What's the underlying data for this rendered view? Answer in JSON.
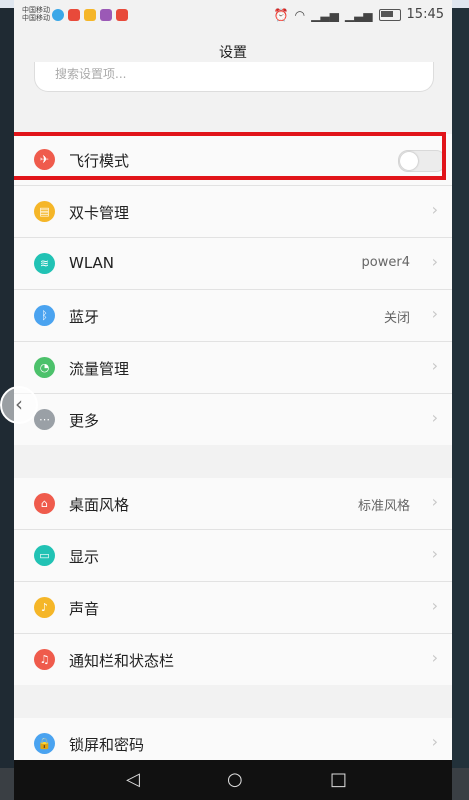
{
  "statusbar": {
    "carrier_1": "中国移动",
    "carrier_2": "中国移动",
    "time": "15:45"
  },
  "title": "设置",
  "search": {
    "placeholder": "搜索设置项..."
  },
  "groups": [
    {
      "items": [
        {
          "label": "飞行模式",
          "icon": "airplane-icon",
          "icon_color": "#ef5b4c",
          "value": "",
          "control": "toggle",
          "toggle_on": false
        },
        {
          "label": "双卡管理",
          "icon": "sim-card-icon",
          "icon_color": "#f5b628",
          "value": ""
        },
        {
          "label": "WLAN",
          "icon": "wifi-icon",
          "icon_color": "#21c2b4",
          "value": "power4"
        },
        {
          "label": "蓝牙",
          "icon": "bluetooth-icon",
          "icon_color": "#4aa3f0",
          "value": "关闭"
        },
        {
          "label": "流量管理",
          "icon": "data-usage-icon",
          "icon_color": "#4cc16b",
          "value": ""
        },
        {
          "label": "更多",
          "icon": "more-icon",
          "icon_color": "#9aa0a6",
          "value": ""
        }
      ]
    },
    {
      "items": [
        {
          "label": "桌面风格",
          "icon": "home-icon",
          "icon_color": "#ef5b4c",
          "value": "标准风格"
        },
        {
          "label": "显示",
          "icon": "display-icon",
          "icon_color": "#21c2b4",
          "value": ""
        },
        {
          "label": "声音",
          "icon": "sound-icon",
          "icon_color": "#f5b628",
          "value": ""
        },
        {
          "label": "通知栏和状态栏",
          "icon": "notification-icon",
          "icon_color": "#ef5b4c",
          "value": ""
        }
      ]
    },
    {
      "items": [
        {
          "label": "锁屏和密码",
          "icon": "lock-icon",
          "icon_color": "#4aa3f0",
          "value": ""
        }
      ]
    }
  ],
  "highlight_color": "#e1141a"
}
